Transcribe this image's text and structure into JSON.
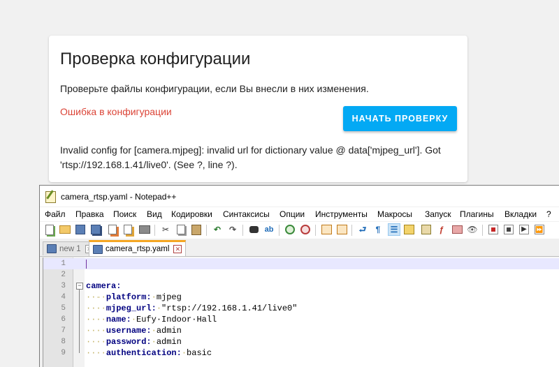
{
  "card": {
    "title": "Проверка конфигурации",
    "description": "Проверьте файлы конфигурации, если Вы внесли в них изменения.",
    "error_label": "Ошибка в конфигурации",
    "check_button": "НАЧАТЬ ПРОВЕРКУ",
    "error_message": "Invalid config for [camera.mjpeg]: invalid url for dictionary value @ data['mjpeg_url']. Got 'rtsp://192.168.1.41/live0'. (See ?, line ?).",
    "colors": {
      "error": "#db4437",
      "button": "#03a9f4"
    }
  },
  "notepad": {
    "window_title": "camera_rtsp.yaml - Notepad++",
    "menu": [
      "Файл",
      "Правка",
      "Поиск",
      "Вид",
      "Кодировки",
      "Синтаксисы",
      "Опции",
      "Инструменты",
      "Макросы",
      "Запуск",
      "Плагины",
      "Вкладки",
      "?"
    ],
    "toolbar_icons": [
      "new-file-icon",
      "open-file-icon",
      "save-icon",
      "save-all-icon",
      "close-icon",
      "close-all-icon",
      "print-icon",
      "cut-icon",
      "copy-icon",
      "paste-icon",
      "undo-icon",
      "redo-icon",
      "find-icon",
      "replace-icon",
      "zoom-in-icon",
      "zoom-out-icon",
      "sync-v-icon",
      "sync-h-icon",
      "word-wrap-icon",
      "show-all-chars-icon",
      "indent-guide-icon",
      "udl-icon",
      "doc-map-icon",
      "function-list-icon",
      "folder-workspace-icon",
      "monitoring-icon",
      "record-macro-icon",
      "stop-record-icon",
      "play-macro-icon",
      "run-macro-multiple-icon"
    ],
    "tabs": [
      {
        "label": "new 1",
        "active": false
      },
      {
        "label": "camera_rtsp.yaml",
        "active": true
      }
    ],
    "lines": [
      {
        "num": "1",
        "text": ""
      },
      {
        "num": "2",
        "text": ""
      },
      {
        "num": "3",
        "key": "camera",
        "value": ""
      },
      {
        "num": "4",
        "key": "platform",
        "value": "mjpeg",
        "prefix": "··-·"
      },
      {
        "num": "5",
        "key": "mjpeg_url",
        "value": "\"rtsp://192.168.1.41/live0\"",
        "prefix": "····"
      },
      {
        "num": "6",
        "key": "name",
        "value": "Eufy·Indoor·Hall",
        "prefix": "····"
      },
      {
        "num": "7",
        "key": "username",
        "value": "admin",
        "prefix": "····"
      },
      {
        "num": "8",
        "key": "password",
        "value": "admin",
        "prefix": "····"
      },
      {
        "num": "9",
        "key": "authentication",
        "value": "basic",
        "prefix": "····"
      }
    ]
  }
}
